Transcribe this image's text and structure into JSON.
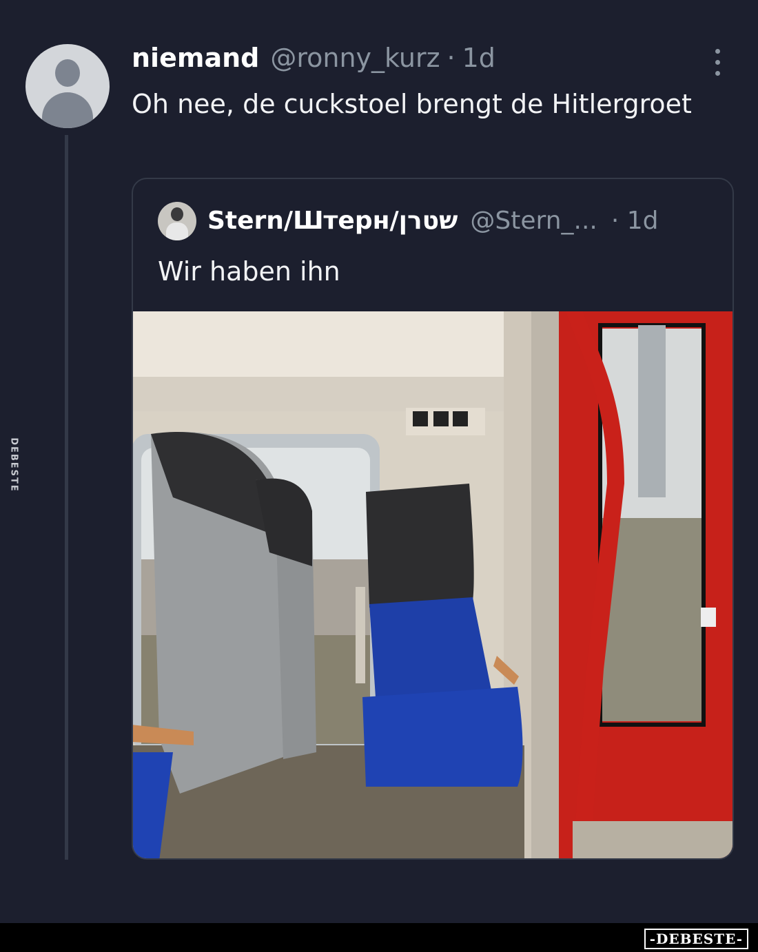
{
  "tweet": {
    "display_name": "niemand",
    "handle": "@ronny_kurz",
    "separator": "·",
    "time": "1d",
    "text": "Oh nee, de cuckstoel brengt de Hitlergroet"
  },
  "quoted_tweet": {
    "display_name": "Stern/Штерн/שטרן",
    "handle": "@Stern_...",
    "separator": "·",
    "time": "1d",
    "text": "Wir haben ihn",
    "media": "photo of a train interior with a single blue seat whose headrest is raised like a saluting arm, next to a red door frame"
  },
  "watermark_side": "DEBESTE",
  "footer": {
    "brand": "-DEBESTE-"
  },
  "colors": {
    "background": "#1c1f2e",
    "primary_text": "#ffffff",
    "secondary_text": "#8b95a1",
    "border": "#343a48"
  },
  "icons": {
    "more": "more-vertical-icon",
    "avatar_placeholder": "default-avatar-icon"
  }
}
